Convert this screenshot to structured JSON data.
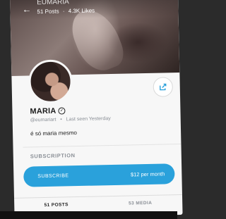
{
  "header": {
    "title": "EUMARIA",
    "posts": "51 Posts",
    "separator": "·",
    "likes": "4.3K Likes"
  },
  "profile": {
    "name": "MARIA",
    "handle": "@eumariart",
    "last_seen": "Last seen Yesterday",
    "bio": "é só maria mesmo"
  },
  "subscription": {
    "heading": "SUBSCRIPTION",
    "button_label": "SUBSCRIBE",
    "price": "$12 per month"
  },
  "tabs": [
    "51 POSTS",
    "53 MEDIA"
  ],
  "colors": {
    "accent": "#2aa1db",
    "muted": "#8a8f96"
  },
  "icons": {
    "back": "arrow-left-icon",
    "share": "share-icon",
    "verified": "verified-check-icon"
  }
}
